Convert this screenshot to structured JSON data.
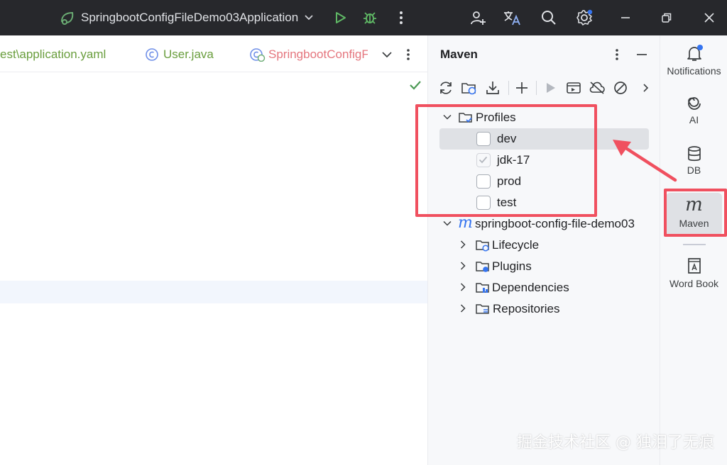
{
  "titlebar": {
    "run_config": "SpringbootConfigFileDemo03Application"
  },
  "editor": {
    "tabs": [
      {
        "label": "est\\application.yaml",
        "color": "#6a9e3e"
      },
      {
        "label": "User.java",
        "color": "#6a9e3e"
      },
      {
        "label": "SpringbootConfigF",
        "color": "#e5767e"
      }
    ]
  },
  "maven": {
    "title": "Maven",
    "profiles_label": "Profiles",
    "profiles": [
      {
        "label": "dev",
        "checked": false,
        "selected": true
      },
      {
        "label": "jdk-17",
        "checked": true,
        "selected": false
      },
      {
        "label": "prod",
        "checked": false,
        "selected": false
      },
      {
        "label": "test",
        "checked": false,
        "selected": false
      }
    ],
    "project": "springboot-config-file-demo03",
    "project_children": [
      "Lifecycle",
      "Plugins",
      "Dependencies",
      "Repositories"
    ]
  },
  "strip": {
    "items": [
      {
        "label": "Notifications",
        "icon": "bell-icon"
      },
      {
        "label": "AI",
        "icon": "ai-icon"
      },
      {
        "label": "DB",
        "icon": "database-icon"
      },
      {
        "label": "Maven",
        "icon": "maven-icon",
        "active": true
      },
      {
        "label": "Word Book",
        "icon": "book-icon"
      }
    ]
  },
  "watermark": "掘金技术社区 @ 独泪了无痕",
  "colors": {
    "accent_blue": "#3574f0",
    "annotation_red": "#f0505f",
    "titlebar_bg": "#27282c"
  }
}
